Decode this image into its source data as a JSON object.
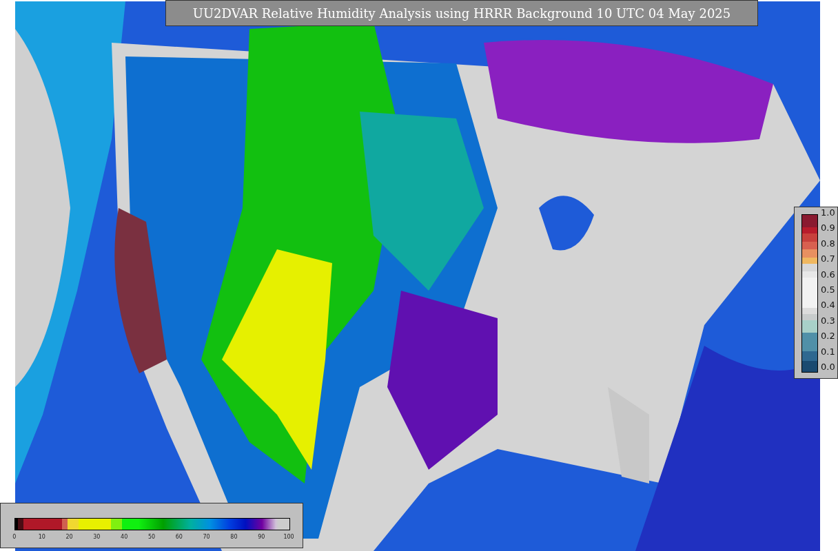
{
  "title": "UU2DVAR Relative Humidity Analysis using HRRR Background 10 UTC 04 May 2025",
  "side_colorbar": {
    "labels": [
      "1.0",
      "0.9",
      "0.8",
      "0.7",
      "0.6",
      "0.5",
      "0.4",
      "0.3",
      "0.2",
      "0.1",
      "0.0"
    ]
  },
  "bottom_colorbar": {
    "labels": [
      "0",
      "10",
      "20",
      "30",
      "40",
      "50",
      "60",
      "70",
      "80",
      "90",
      "100"
    ]
  }
}
